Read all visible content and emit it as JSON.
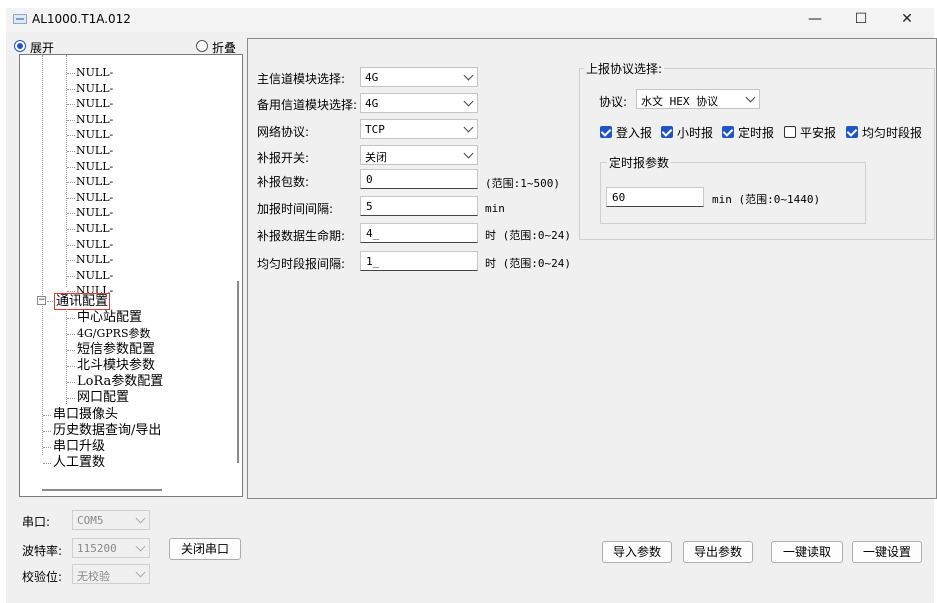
{
  "window": {
    "title": "AL1000.T1A.012",
    "minimize_glyph": "—",
    "maximize_glyph": "☐",
    "close_glyph": "✕"
  },
  "view_mode": {
    "expand_label": "展开",
    "collapse_label": "折叠",
    "selected": "展开"
  },
  "tree": {
    "null_items": [
      "NULL-",
      "NULL-",
      "NULL-",
      "NULL-",
      "NULL-",
      "NULL-",
      "NULL-",
      "NULL-",
      "NULL-",
      "NULL-",
      "NULL-",
      "NULL-",
      "NULL-",
      "NULL-",
      "NULL-"
    ],
    "comm_config": {
      "label": "通讯配置",
      "children": [
        "中心站配置",
        "4G/GPRS参数",
        "短信参数配置",
        "北斗模块参数",
        "LoRa参数配置",
        "网口配置"
      ]
    },
    "bottom_items": [
      "串口摄像头",
      "历史数据查询/导出",
      "串口升级",
      "人工置数"
    ]
  },
  "form": {
    "main_channel": {
      "label": "主信道模块选择:",
      "value": "4G"
    },
    "backup_channel": {
      "label": "备用信道模块选择:",
      "value": "4G"
    },
    "net_protocol": {
      "label": "网络协议:",
      "value": "TCP"
    },
    "resend_switch": {
      "label": "补报开关:",
      "value": "关闭"
    },
    "resend_packets": {
      "label": "补报包数:",
      "value": "0",
      "hint": "(范围:1~500)"
    },
    "add_interval": {
      "label": "加报时间间隔:",
      "value": "5",
      "unit": "min"
    },
    "resend_lifetime": {
      "label": "补报数据生命期:",
      "value": "4_",
      "hint": "时 (范围:0~24)"
    },
    "even_interval": {
      "label": "均匀时段报间隔:",
      "value": "1_",
      "hint": "时 (范围:0~24)"
    }
  },
  "report_protocol": {
    "group_title": "上报协议选择:",
    "protocol_label": "协议:",
    "protocol_value": "水文 HEX 协议",
    "checkboxes": [
      {
        "label": "登入报",
        "checked": true
      },
      {
        "label": "小时报",
        "checked": true
      },
      {
        "label": "定时报",
        "checked": true
      },
      {
        "label": "平安报",
        "checked": false
      },
      {
        "label": "均匀时段报",
        "checked": true
      }
    ],
    "timed_group_title": "定时报参数",
    "timed_value": "60",
    "timed_hint": "min (范围:0~1440)"
  },
  "serial": {
    "port_label": "串口:",
    "port_value": "COM5",
    "baud_label": "波特率:",
    "baud_value": "115200",
    "parity_label": "校验位:",
    "parity_value": "无校验",
    "close_button": "关闭串口"
  },
  "actions": {
    "import": "导入参数",
    "export": "导出参数",
    "read_all": "一键读取",
    "set_all": "一键设置"
  },
  "colors": {
    "accent": "#1f55c7",
    "tree_highlight_border": "#e53935"
  }
}
